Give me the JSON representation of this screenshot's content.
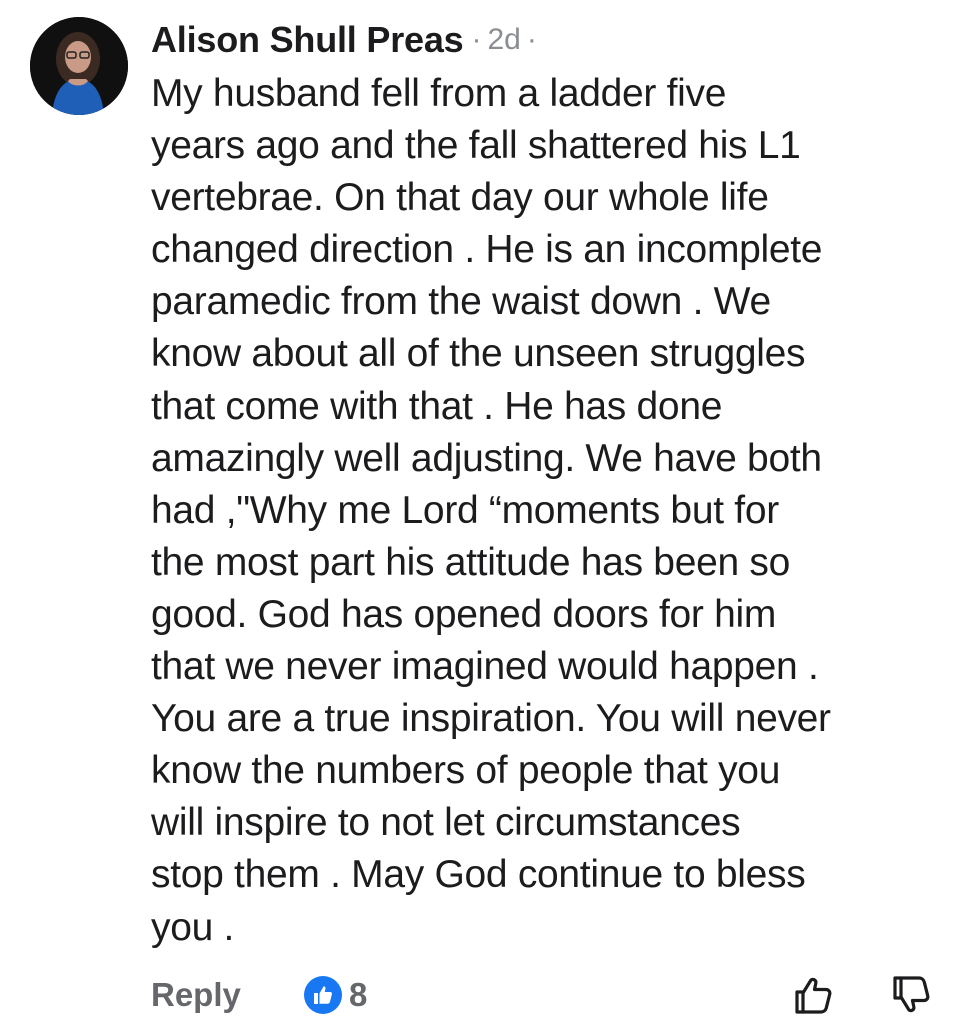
{
  "comment": {
    "author": "Alison Shull Preas",
    "separator": "·",
    "time": "2d",
    "lines": [
      "My husband fell from a ladder five",
      "years ago and the fall shattered his L1",
      "vertebrae. On that day our whole life",
      "changed direction . He is an incomplete",
      "paramedic from the waist down . We",
      "know about all of the unseen struggles",
      "that come with that . He has done",
      "amazingly well adjusting. We have both",
      "had ,\"Why me Lord “moments but for",
      "the most part his attitude has been so",
      "good. God has opened doors for him",
      "that we never imagined would happen .",
      "You are a true inspiration. You will never",
      "know the numbers of people that you",
      "will inspire to not let circumstances",
      "stop them . May God continue to bless",
      "you ."
    ]
  },
  "actions": {
    "reply_label": "Reply",
    "like_count": "8",
    "reaction_icon": "like-thumb-icon",
    "upvote_icon": "thumbs-up-outline-icon",
    "downvote_icon": "thumbs-down-outline-icon"
  },
  "colors": {
    "text": "#1c1c1e",
    "muted": "#65676b",
    "meta": "#8a8d91",
    "like_blue": "#1877f2"
  }
}
